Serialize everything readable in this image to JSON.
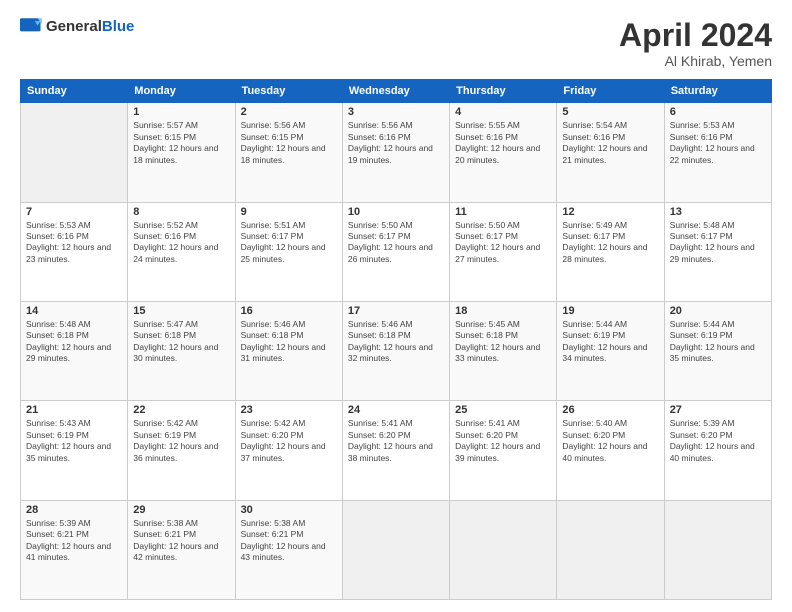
{
  "header": {
    "logo_general": "General",
    "logo_blue": "Blue",
    "title": "April 2024",
    "subtitle": "Al Khirab, Yemen"
  },
  "days_of_week": [
    "Sunday",
    "Monday",
    "Tuesday",
    "Wednesday",
    "Thursday",
    "Friday",
    "Saturday"
  ],
  "weeks": [
    [
      {
        "day": "",
        "sunrise": "",
        "sunset": "",
        "daylight": "",
        "empty": true
      },
      {
        "day": "1",
        "sunrise": "Sunrise: 5:57 AM",
        "sunset": "Sunset: 6:15 PM",
        "daylight": "Daylight: 12 hours and 18 minutes."
      },
      {
        "day": "2",
        "sunrise": "Sunrise: 5:56 AM",
        "sunset": "Sunset: 6:15 PM",
        "daylight": "Daylight: 12 hours and 18 minutes."
      },
      {
        "day": "3",
        "sunrise": "Sunrise: 5:56 AM",
        "sunset": "Sunset: 6:16 PM",
        "daylight": "Daylight: 12 hours and 19 minutes."
      },
      {
        "day": "4",
        "sunrise": "Sunrise: 5:55 AM",
        "sunset": "Sunset: 6:16 PM",
        "daylight": "Daylight: 12 hours and 20 minutes."
      },
      {
        "day": "5",
        "sunrise": "Sunrise: 5:54 AM",
        "sunset": "Sunset: 6:16 PM",
        "daylight": "Daylight: 12 hours and 21 minutes."
      },
      {
        "day": "6",
        "sunrise": "Sunrise: 5:53 AM",
        "sunset": "Sunset: 6:16 PM",
        "daylight": "Daylight: 12 hours and 22 minutes."
      }
    ],
    [
      {
        "day": "7",
        "sunrise": "Sunrise: 5:53 AM",
        "sunset": "Sunset: 6:16 PM",
        "daylight": "Daylight: 12 hours and 23 minutes."
      },
      {
        "day": "8",
        "sunrise": "Sunrise: 5:52 AM",
        "sunset": "Sunset: 6:16 PM",
        "daylight": "Daylight: 12 hours and 24 minutes."
      },
      {
        "day": "9",
        "sunrise": "Sunrise: 5:51 AM",
        "sunset": "Sunset: 6:17 PM",
        "daylight": "Daylight: 12 hours and 25 minutes."
      },
      {
        "day": "10",
        "sunrise": "Sunrise: 5:50 AM",
        "sunset": "Sunset: 6:17 PM",
        "daylight": "Daylight: 12 hours and 26 minutes."
      },
      {
        "day": "11",
        "sunrise": "Sunrise: 5:50 AM",
        "sunset": "Sunset: 6:17 PM",
        "daylight": "Daylight: 12 hours and 27 minutes."
      },
      {
        "day": "12",
        "sunrise": "Sunrise: 5:49 AM",
        "sunset": "Sunset: 6:17 PM",
        "daylight": "Daylight: 12 hours and 28 minutes."
      },
      {
        "day": "13",
        "sunrise": "Sunrise: 5:48 AM",
        "sunset": "Sunset: 6:17 PM",
        "daylight": "Daylight: 12 hours and 29 minutes."
      }
    ],
    [
      {
        "day": "14",
        "sunrise": "Sunrise: 5:48 AM",
        "sunset": "Sunset: 6:18 PM",
        "daylight": "Daylight: 12 hours and 29 minutes."
      },
      {
        "day": "15",
        "sunrise": "Sunrise: 5:47 AM",
        "sunset": "Sunset: 6:18 PM",
        "daylight": "Daylight: 12 hours and 30 minutes."
      },
      {
        "day": "16",
        "sunrise": "Sunrise: 5:46 AM",
        "sunset": "Sunset: 6:18 PM",
        "daylight": "Daylight: 12 hours and 31 minutes."
      },
      {
        "day": "17",
        "sunrise": "Sunrise: 5:46 AM",
        "sunset": "Sunset: 6:18 PM",
        "daylight": "Daylight: 12 hours and 32 minutes."
      },
      {
        "day": "18",
        "sunrise": "Sunrise: 5:45 AM",
        "sunset": "Sunset: 6:18 PM",
        "daylight": "Daylight: 12 hours and 33 minutes."
      },
      {
        "day": "19",
        "sunrise": "Sunrise: 5:44 AM",
        "sunset": "Sunset: 6:19 PM",
        "daylight": "Daylight: 12 hours and 34 minutes."
      },
      {
        "day": "20",
        "sunrise": "Sunrise: 5:44 AM",
        "sunset": "Sunset: 6:19 PM",
        "daylight": "Daylight: 12 hours and 35 minutes."
      }
    ],
    [
      {
        "day": "21",
        "sunrise": "Sunrise: 5:43 AM",
        "sunset": "Sunset: 6:19 PM",
        "daylight": "Daylight: 12 hours and 35 minutes."
      },
      {
        "day": "22",
        "sunrise": "Sunrise: 5:42 AM",
        "sunset": "Sunset: 6:19 PM",
        "daylight": "Daylight: 12 hours and 36 minutes."
      },
      {
        "day": "23",
        "sunrise": "Sunrise: 5:42 AM",
        "sunset": "Sunset: 6:20 PM",
        "daylight": "Daylight: 12 hours and 37 minutes."
      },
      {
        "day": "24",
        "sunrise": "Sunrise: 5:41 AM",
        "sunset": "Sunset: 6:20 PM",
        "daylight": "Daylight: 12 hours and 38 minutes."
      },
      {
        "day": "25",
        "sunrise": "Sunrise: 5:41 AM",
        "sunset": "Sunset: 6:20 PM",
        "daylight": "Daylight: 12 hours and 39 minutes."
      },
      {
        "day": "26",
        "sunrise": "Sunrise: 5:40 AM",
        "sunset": "Sunset: 6:20 PM",
        "daylight": "Daylight: 12 hours and 40 minutes."
      },
      {
        "day": "27",
        "sunrise": "Sunrise: 5:39 AM",
        "sunset": "Sunset: 6:20 PM",
        "daylight": "Daylight: 12 hours and 40 minutes."
      }
    ],
    [
      {
        "day": "28",
        "sunrise": "Sunrise: 5:39 AM",
        "sunset": "Sunset: 6:21 PM",
        "daylight": "Daylight: 12 hours and 41 minutes."
      },
      {
        "day": "29",
        "sunrise": "Sunrise: 5:38 AM",
        "sunset": "Sunset: 6:21 PM",
        "daylight": "Daylight: 12 hours and 42 minutes."
      },
      {
        "day": "30",
        "sunrise": "Sunrise: 5:38 AM",
        "sunset": "Sunset: 6:21 PM",
        "daylight": "Daylight: 12 hours and 43 minutes."
      },
      {
        "day": "",
        "sunrise": "",
        "sunset": "",
        "daylight": "",
        "empty": true
      },
      {
        "day": "",
        "sunrise": "",
        "sunset": "",
        "daylight": "",
        "empty": true
      },
      {
        "day": "",
        "sunrise": "",
        "sunset": "",
        "daylight": "",
        "empty": true
      },
      {
        "day": "",
        "sunrise": "",
        "sunset": "",
        "daylight": "",
        "empty": true
      }
    ]
  ]
}
